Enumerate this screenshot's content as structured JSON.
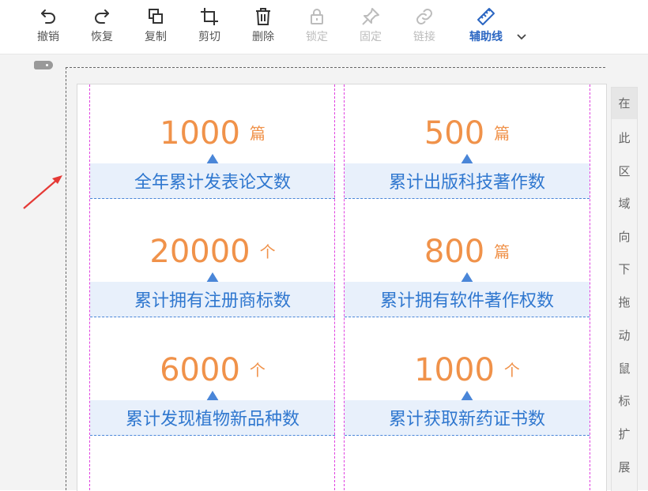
{
  "toolbar": {
    "items": [
      {
        "label": "撤销",
        "icon": "undo-icon"
      },
      {
        "label": "恢复",
        "icon": "redo-icon"
      },
      {
        "label": "复制",
        "icon": "copy-icon"
      },
      {
        "label": "剪切",
        "icon": "crop-icon"
      },
      {
        "label": "删除",
        "icon": "trash-icon"
      },
      {
        "label": "锁定",
        "icon": "lock-icon",
        "disabled": true
      },
      {
        "label": "固定",
        "icon": "pin-icon",
        "disabled": true
      },
      {
        "label": "链接",
        "icon": "link-icon",
        "disabled": true
      },
      {
        "label": "辅助线",
        "icon": "ruler-icon",
        "active": true
      }
    ]
  },
  "cards": [
    {
      "value": "1000",
      "unit": "篇",
      "label": "全年累计发表论文数"
    },
    {
      "value": "500",
      "unit": "篇",
      "label": "累计出版科技著作数"
    },
    {
      "value": "20000",
      "unit": "个",
      "label": "累计拥有注册商标数"
    },
    {
      "value": "800",
      "unit": "篇",
      "label": "累计拥有软件著作权数"
    },
    {
      "value": "6000",
      "unit": "个",
      "label": "累计发现植物新品种数"
    },
    {
      "value": "1000",
      "unit": "个",
      "label": "累计获取新药证书数"
    }
  ],
  "side_hint": [
    "在",
    "此",
    "区",
    "域",
    "向",
    "下",
    "拖",
    "动",
    "鼠",
    "标",
    "扩",
    "展"
  ],
  "colors": {
    "accent": "#2b66c2",
    "number": "#f0924a",
    "band_bg": "#e8f0fb",
    "band_text": "#2f77cf",
    "guide": "#e040e0",
    "arrow": "#e53935"
  }
}
